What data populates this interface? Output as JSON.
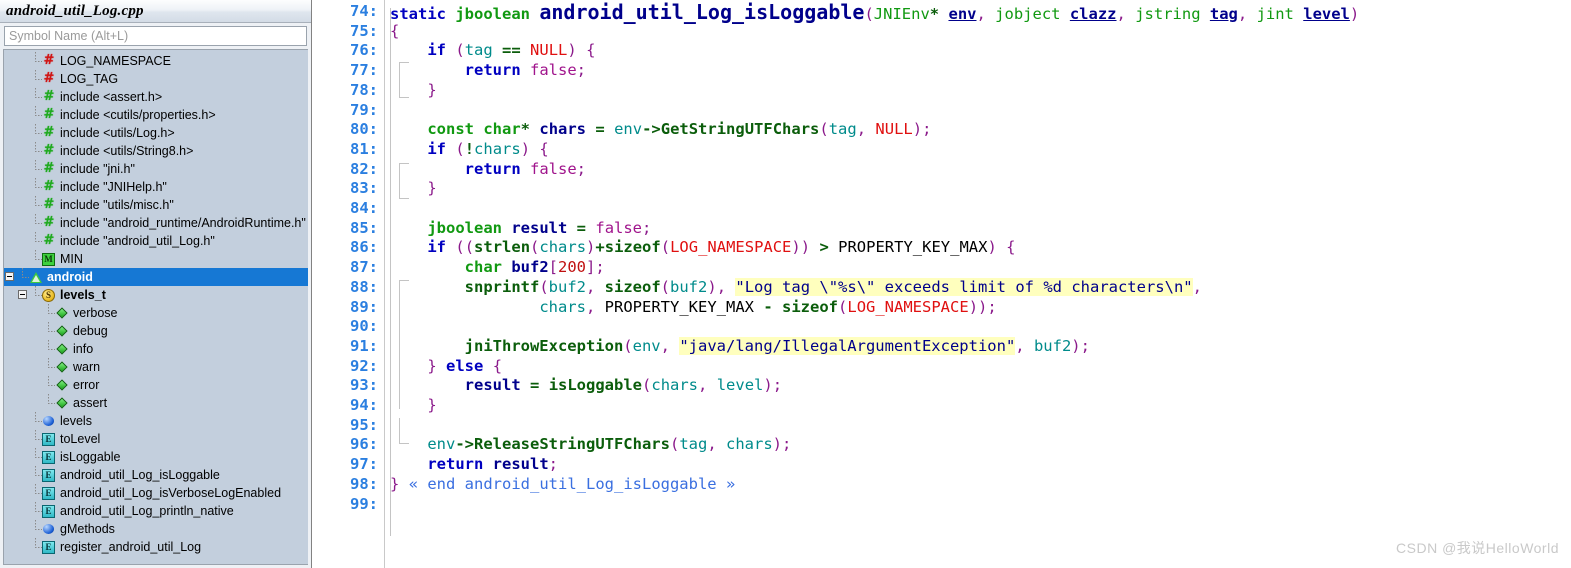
{
  "symbol_panel": {
    "title": "android_util_Log.cpp",
    "search_placeholder": "Symbol Name (Alt+L)",
    "search_value": "",
    "items": [
      {
        "label": "LOG_NAMESPACE",
        "icon": "macro-red-hash-icon",
        "depth": 1,
        "kind": "macro"
      },
      {
        "label": "LOG_TAG",
        "icon": "macro-red-hash-icon",
        "depth": 1,
        "kind": "macro"
      },
      {
        "label": "include <assert.h>",
        "icon": "include-green-hash-icon",
        "depth": 1,
        "kind": "include"
      },
      {
        "label": "include <cutils/properties.h>",
        "icon": "include-green-hash-icon",
        "depth": 1,
        "kind": "include"
      },
      {
        "label": "include <utils/Log.h>",
        "icon": "include-green-hash-icon",
        "depth": 1,
        "kind": "include"
      },
      {
        "label": "include <utils/String8.h>",
        "icon": "include-green-hash-icon",
        "depth": 1,
        "kind": "include"
      },
      {
        "label": "include \"jni.h\"",
        "icon": "include-green-hash-icon",
        "depth": 1,
        "kind": "include"
      },
      {
        "label": "include \"JNIHelp.h\"",
        "icon": "include-green-hash-icon",
        "depth": 1,
        "kind": "include"
      },
      {
        "label": "include \"utils/misc.h\"",
        "icon": "include-green-hash-icon",
        "depth": 1,
        "kind": "include"
      },
      {
        "label": "include \"android_runtime/AndroidRuntime.h\"",
        "icon": "include-green-hash-icon",
        "depth": 1,
        "kind": "include"
      },
      {
        "label": "include \"android_util_Log.h\"",
        "icon": "include-green-hash-icon",
        "depth": 1,
        "kind": "include"
      },
      {
        "label": "MIN",
        "icon": "macro-m-box-icon",
        "depth": 1,
        "kind": "macro-func"
      },
      {
        "label": "android",
        "icon": "namespace-triangle-icon",
        "depth": 0,
        "kind": "namespace",
        "selected": true,
        "expanded": true
      },
      {
        "label": "levels_t",
        "icon": "struct-s-circle-icon",
        "depth": 1,
        "kind": "struct",
        "expanded": true,
        "bold": true
      },
      {
        "label": "verbose",
        "icon": "enum-diamond-icon",
        "depth": 2,
        "kind": "enumerator"
      },
      {
        "label": "debug",
        "icon": "enum-diamond-icon",
        "depth": 2,
        "kind": "enumerator"
      },
      {
        "label": "info",
        "icon": "enum-diamond-icon",
        "depth": 2,
        "kind": "enumerator"
      },
      {
        "label": "warn",
        "icon": "enum-diamond-icon",
        "depth": 2,
        "kind": "enumerator"
      },
      {
        "label": "error",
        "icon": "enum-diamond-icon",
        "depth": 2,
        "kind": "enumerator"
      },
      {
        "label": "assert",
        "icon": "enum-diamond-icon",
        "depth": 2,
        "kind": "enumerator"
      },
      {
        "label": "levels",
        "icon": "variable-sphere-icon",
        "depth": 1,
        "kind": "variable"
      },
      {
        "label": "toLevel",
        "icon": "function-box-icon",
        "depth": 1,
        "kind": "function"
      },
      {
        "label": "isLoggable",
        "icon": "function-box-icon",
        "depth": 1,
        "kind": "function"
      },
      {
        "label": "android_util_Log_isLoggable",
        "icon": "function-box-icon",
        "depth": 1,
        "kind": "function"
      },
      {
        "label": "android_util_Log_isVerboseLogEnabled",
        "icon": "function-box-icon",
        "depth": 1,
        "kind": "function"
      },
      {
        "label": "android_util_Log_println_native",
        "icon": "function-box-icon",
        "depth": 1,
        "kind": "function"
      },
      {
        "label": "gMethods",
        "icon": "variable-sphere-icon",
        "depth": 1,
        "kind": "variable"
      },
      {
        "label": "register_android_util_Log",
        "icon": "function-box-icon",
        "depth": 1,
        "kind": "function"
      }
    ]
  },
  "editor": {
    "first_line": 74,
    "last_line": 99,
    "lines": [
      {
        "n": "74:",
        "text": "static jboolean android_util_Log_isLoggable(JNIEnv* env, jobject clazz, jstring tag, jint level)"
      },
      {
        "n": "75:",
        "text": "{"
      },
      {
        "n": "76:",
        "text": "    if (tag == NULL) {"
      },
      {
        "n": "77:",
        "text": "        return false;"
      },
      {
        "n": "78:",
        "text": "    }"
      },
      {
        "n": "79:",
        "text": ""
      },
      {
        "n": "80:",
        "text": "    const char* chars = env->GetStringUTFChars(tag, NULL);"
      },
      {
        "n": "81:",
        "text": "    if (!chars) {"
      },
      {
        "n": "82:",
        "text": "        return false;"
      },
      {
        "n": "83:",
        "text": "    }"
      },
      {
        "n": "84:",
        "text": ""
      },
      {
        "n": "85:",
        "text": "    jboolean result = false;"
      },
      {
        "n": "86:",
        "text": "    if ((strlen(chars)+sizeof(LOG_NAMESPACE)) > PROPERTY_KEY_MAX) {"
      },
      {
        "n": "87:",
        "text": "        char buf2[200];"
      },
      {
        "n": "88:",
        "text": "        snprintf(buf2, sizeof(buf2), \"Log tag \\\"%s\\\" exceeds limit of %d characters\\n\","
      },
      {
        "n": "89:",
        "text": "                chars, PROPERTY_KEY_MAX - sizeof(LOG_NAMESPACE));"
      },
      {
        "n": "90:",
        "text": ""
      },
      {
        "n": "91:",
        "text": "        jniThrowException(env, \"java/lang/IllegalArgumentException\", buf2);"
      },
      {
        "n": "92:",
        "text": "    } else {"
      },
      {
        "n": "93:",
        "text": "        result = isLoggable(chars, level);"
      },
      {
        "n": "94:",
        "text": "    }"
      },
      {
        "n": "95:",
        "text": ""
      },
      {
        "n": "96:",
        "text": "    env->ReleaseStringUTFChars(tag, chars);"
      },
      {
        "n": "97:",
        "text": "    return result;"
      },
      {
        "n": "98:",
        "text": "} « end android_util_Log_isLoggable »"
      },
      {
        "n": "99:",
        "text": ""
      }
    ]
  },
  "watermark": "CSDN @我说HelloWorld",
  "colors": {
    "selection": "#1678d4",
    "tree_background": "#c3cfdd",
    "line_number": "#2b7fe0",
    "string_highlight": "#ffffbe",
    "keyword": "#0000c0",
    "type": "#119911",
    "macro": "#e01010"
  }
}
